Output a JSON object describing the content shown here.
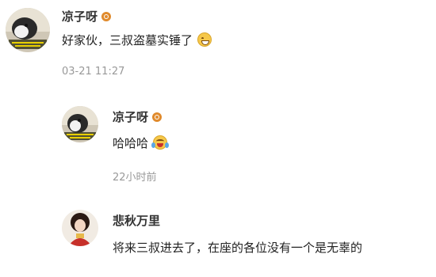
{
  "comments": [
    {
      "username": "凉子呀",
      "text": "好家伙，三叔盗墓实锤了",
      "emoji": "grin-emoji",
      "time": "03-21 11:27"
    },
    {
      "username": "凉子呀",
      "text": "哈哈哈",
      "emoji": "laugh-cry-emoji",
      "time": "22小时前"
    },
    {
      "username": "悲秋万里",
      "text": "将来三叔进去了，在座的各位没有一个是无辜的"
    }
  ],
  "colors": {
    "badge": "#e08a2c",
    "time": "#999999",
    "username": "#333333"
  }
}
